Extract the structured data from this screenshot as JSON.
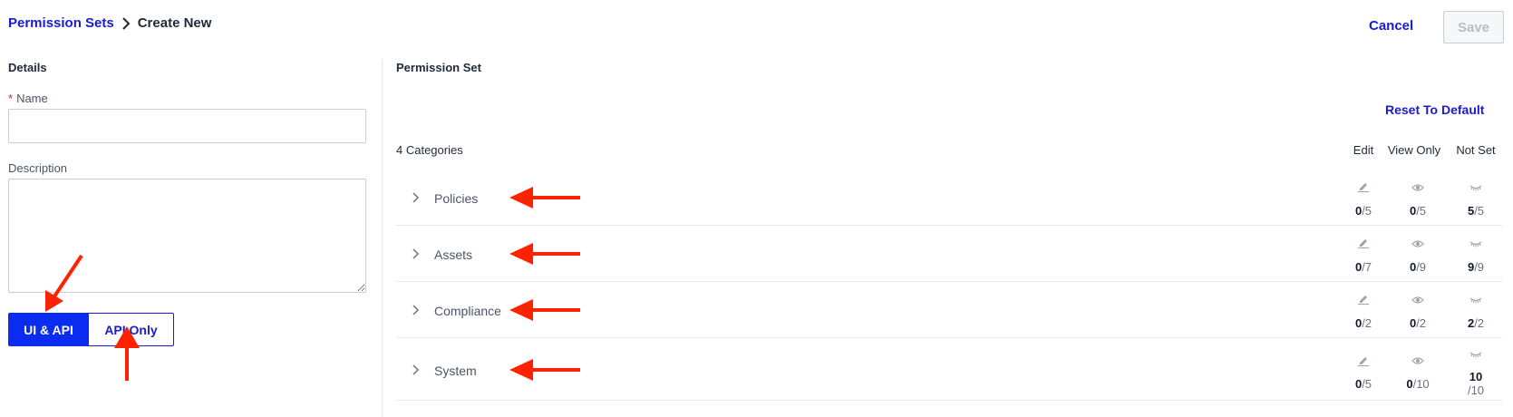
{
  "breadcrumb": {
    "parent": "Permission Sets",
    "current": "Create New"
  },
  "actions": {
    "cancel": "Cancel",
    "save": "Save"
  },
  "details": {
    "title": "Details",
    "name_label": "Name",
    "name_required_mark": "*",
    "name_value": "",
    "description_label": "Description",
    "description_value": "",
    "access_toggle": {
      "options": [
        "UI & API",
        "API Only"
      ],
      "selected": "UI & API"
    }
  },
  "permission_set": {
    "title": "Permission Set",
    "reset_label": "Reset To Default",
    "category_count": "4 Categories",
    "columns": [
      "Edit",
      "View Only",
      "Not Set"
    ],
    "rows": [
      {
        "label": "Policies",
        "edit": {
          "n": "0",
          "d": "/5"
        },
        "view": {
          "n": "0",
          "d": "/5"
        },
        "notset": {
          "n": "5",
          "d": "/5"
        }
      },
      {
        "label": "Assets",
        "edit": {
          "n": "0",
          "d": "/7"
        },
        "view": {
          "n": "0",
          "d": "/9"
        },
        "notset": {
          "n": "9",
          "d": "/9"
        }
      },
      {
        "label": "Compliance",
        "edit": {
          "n": "0",
          "d": "/2"
        },
        "view": {
          "n": "0",
          "d": "/2"
        },
        "notset": {
          "n": "2",
          "d": "/2"
        }
      },
      {
        "label": "System",
        "edit": {
          "n": "0",
          "d": "/5"
        },
        "view": {
          "n": "0",
          "d": "/10"
        },
        "notset": {
          "n": "10",
          "d": "/10"
        }
      }
    ]
  },
  "colors": {
    "accent": "#1a1acf",
    "toggle_active": "#0a2cf0",
    "annotation_arrow": "#ff2200",
    "required": "#dc2626"
  },
  "icons": [
    "chevron-right-icon",
    "pencil-icon",
    "eye-icon",
    "eye-closed-icon",
    "annotation-arrow"
  ]
}
